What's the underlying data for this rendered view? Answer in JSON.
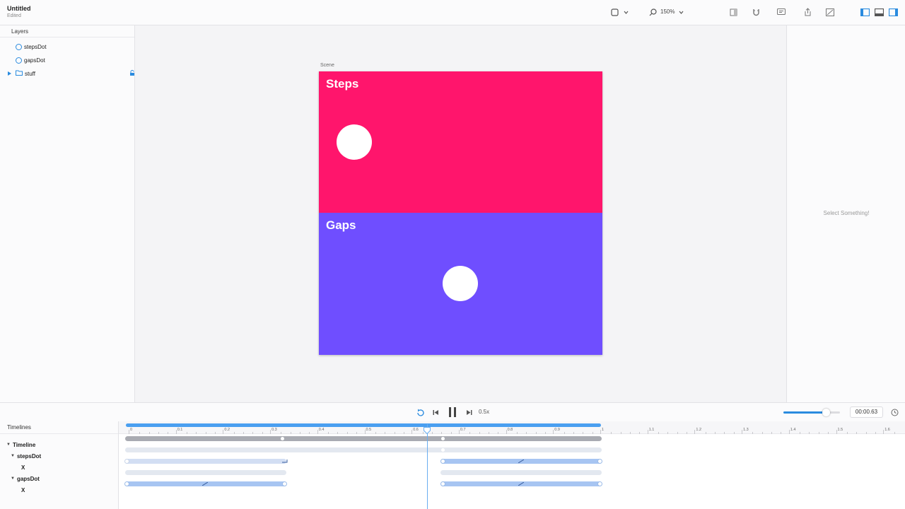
{
  "header": {
    "title": "Untitled",
    "subtitle": "Edited",
    "zoom": "150%"
  },
  "layers": {
    "heading": "Layers",
    "items": [
      {
        "label": "stepsDot",
        "type": "ellipse"
      },
      {
        "label": "gapsDot",
        "type": "ellipse"
      },
      {
        "label": "stuff",
        "type": "group",
        "locked": true
      }
    ]
  },
  "canvas": {
    "scene_label": "Scene",
    "top_title": "Steps",
    "bottom_title": "Gaps",
    "top_color": "#ff156c",
    "bottom_color": "#6f4eff"
  },
  "inspector": {
    "empty_text": "Select Something!"
  },
  "transport": {
    "speed": "0.5x",
    "time": "00:00.63",
    "volume_level": 0.75
  },
  "timeline": {
    "heading": "Timelines",
    "tree": [
      {
        "label": "Timeline",
        "level": 0,
        "expandable": true
      },
      {
        "label": "stepsDot",
        "level": 1,
        "expandable": true
      },
      {
        "label": "X",
        "level": 2,
        "expandable": false
      },
      {
        "label": "gapsDot",
        "level": 1,
        "expandable": true
      },
      {
        "label": "X",
        "level": 2,
        "expandable": false
      }
    ],
    "ruler_labels": [
      "0",
      "0.1",
      "0.2",
      "0.3",
      "0.4",
      "0.5",
      "0.6",
      "0.7",
      "0.8",
      "0.9",
      "1",
      "1.1",
      "1.2",
      "1.3",
      "1.4",
      "1.5",
      "1.6"
    ],
    "playhead_time": 0.63,
    "range_end": 1.0,
    "accent": "#4a9ff0"
  }
}
